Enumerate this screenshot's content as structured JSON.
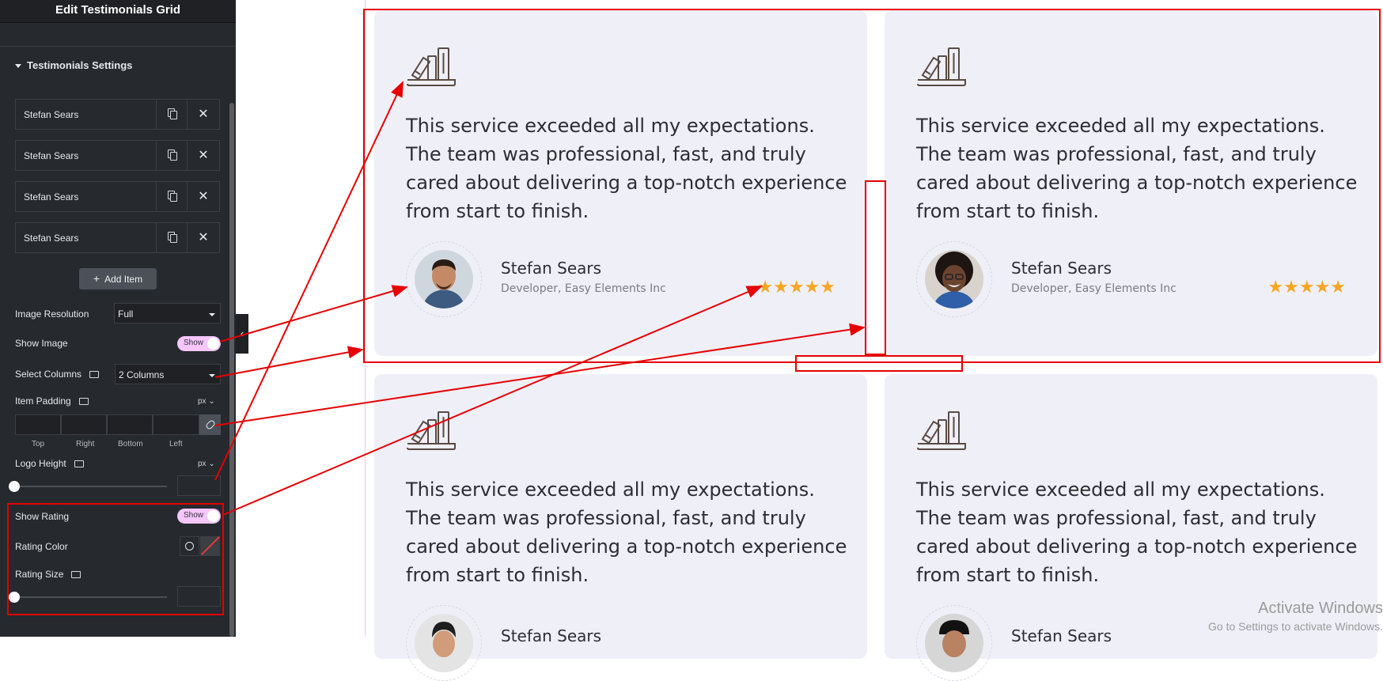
{
  "panel": {
    "title": "Edit Testimonials Grid",
    "section_label": "Testimonials Settings",
    "items": [
      {
        "label": "Stefan Sears"
      },
      {
        "label": "Stefan Sears"
      },
      {
        "label": "Stefan Sears"
      },
      {
        "label": "Stefan Sears"
      }
    ],
    "add_item_label": "Add Item",
    "image_resolution_label": "Image Resolution",
    "image_resolution_value": "Full",
    "show_image_label": "Show Image",
    "show_image_toggle": "Show",
    "select_columns_label": "Select Columns",
    "select_columns_value": "2 Columns",
    "item_padding_label": "Item Padding",
    "item_padding_unit": "px",
    "padding_labels": {
      "top": "Top",
      "right": "Right",
      "bottom": "Bottom",
      "left": "Left"
    },
    "logo_height_label": "Logo Height",
    "logo_height_unit": "px",
    "show_rating_label": "Show Rating",
    "show_rating_toggle": "Show",
    "rating_color_label": "Rating Color",
    "rating_size_label": "Rating Size"
  },
  "cards": [
    {
      "quote": "This service exceeded all my expectations. The team was professional, fast, and truly cared about delivering a top-notch experience from start to finish.",
      "name": "Stefan Sears",
      "role": "Developer, Easy Elements Inc",
      "stars": "★★★★★",
      "rating": 5
    },
    {
      "quote": "This service exceeded all my expectations. The team was professional, fast, and truly cared about delivering a top-notch experience from start to finish.",
      "name": "Stefan Sears",
      "role": "Developer, Easy Elements Inc",
      "stars": "★★★★★",
      "rating": 5
    },
    {
      "quote": "This service exceeded all my expectations. The team was professional, fast, and truly cared about delivering a top-notch experience from start to finish.",
      "name": "Stefan Sears"
    },
    {
      "quote": "This service exceeded all my expectations. The team was professional, fast, and truly cared about delivering a top-notch experience from start to finish.",
      "name": "Stefan Sears"
    }
  ],
  "watermark": {
    "title": "Activate Windows",
    "subtitle": "Go to Settings to activate Windows."
  },
  "colors": {
    "panel_bg": "#26292e",
    "card_bg": "#efeff8",
    "star": "#f5a623",
    "toggle_on": "#f6c6ff",
    "annotation": "#e60000"
  }
}
